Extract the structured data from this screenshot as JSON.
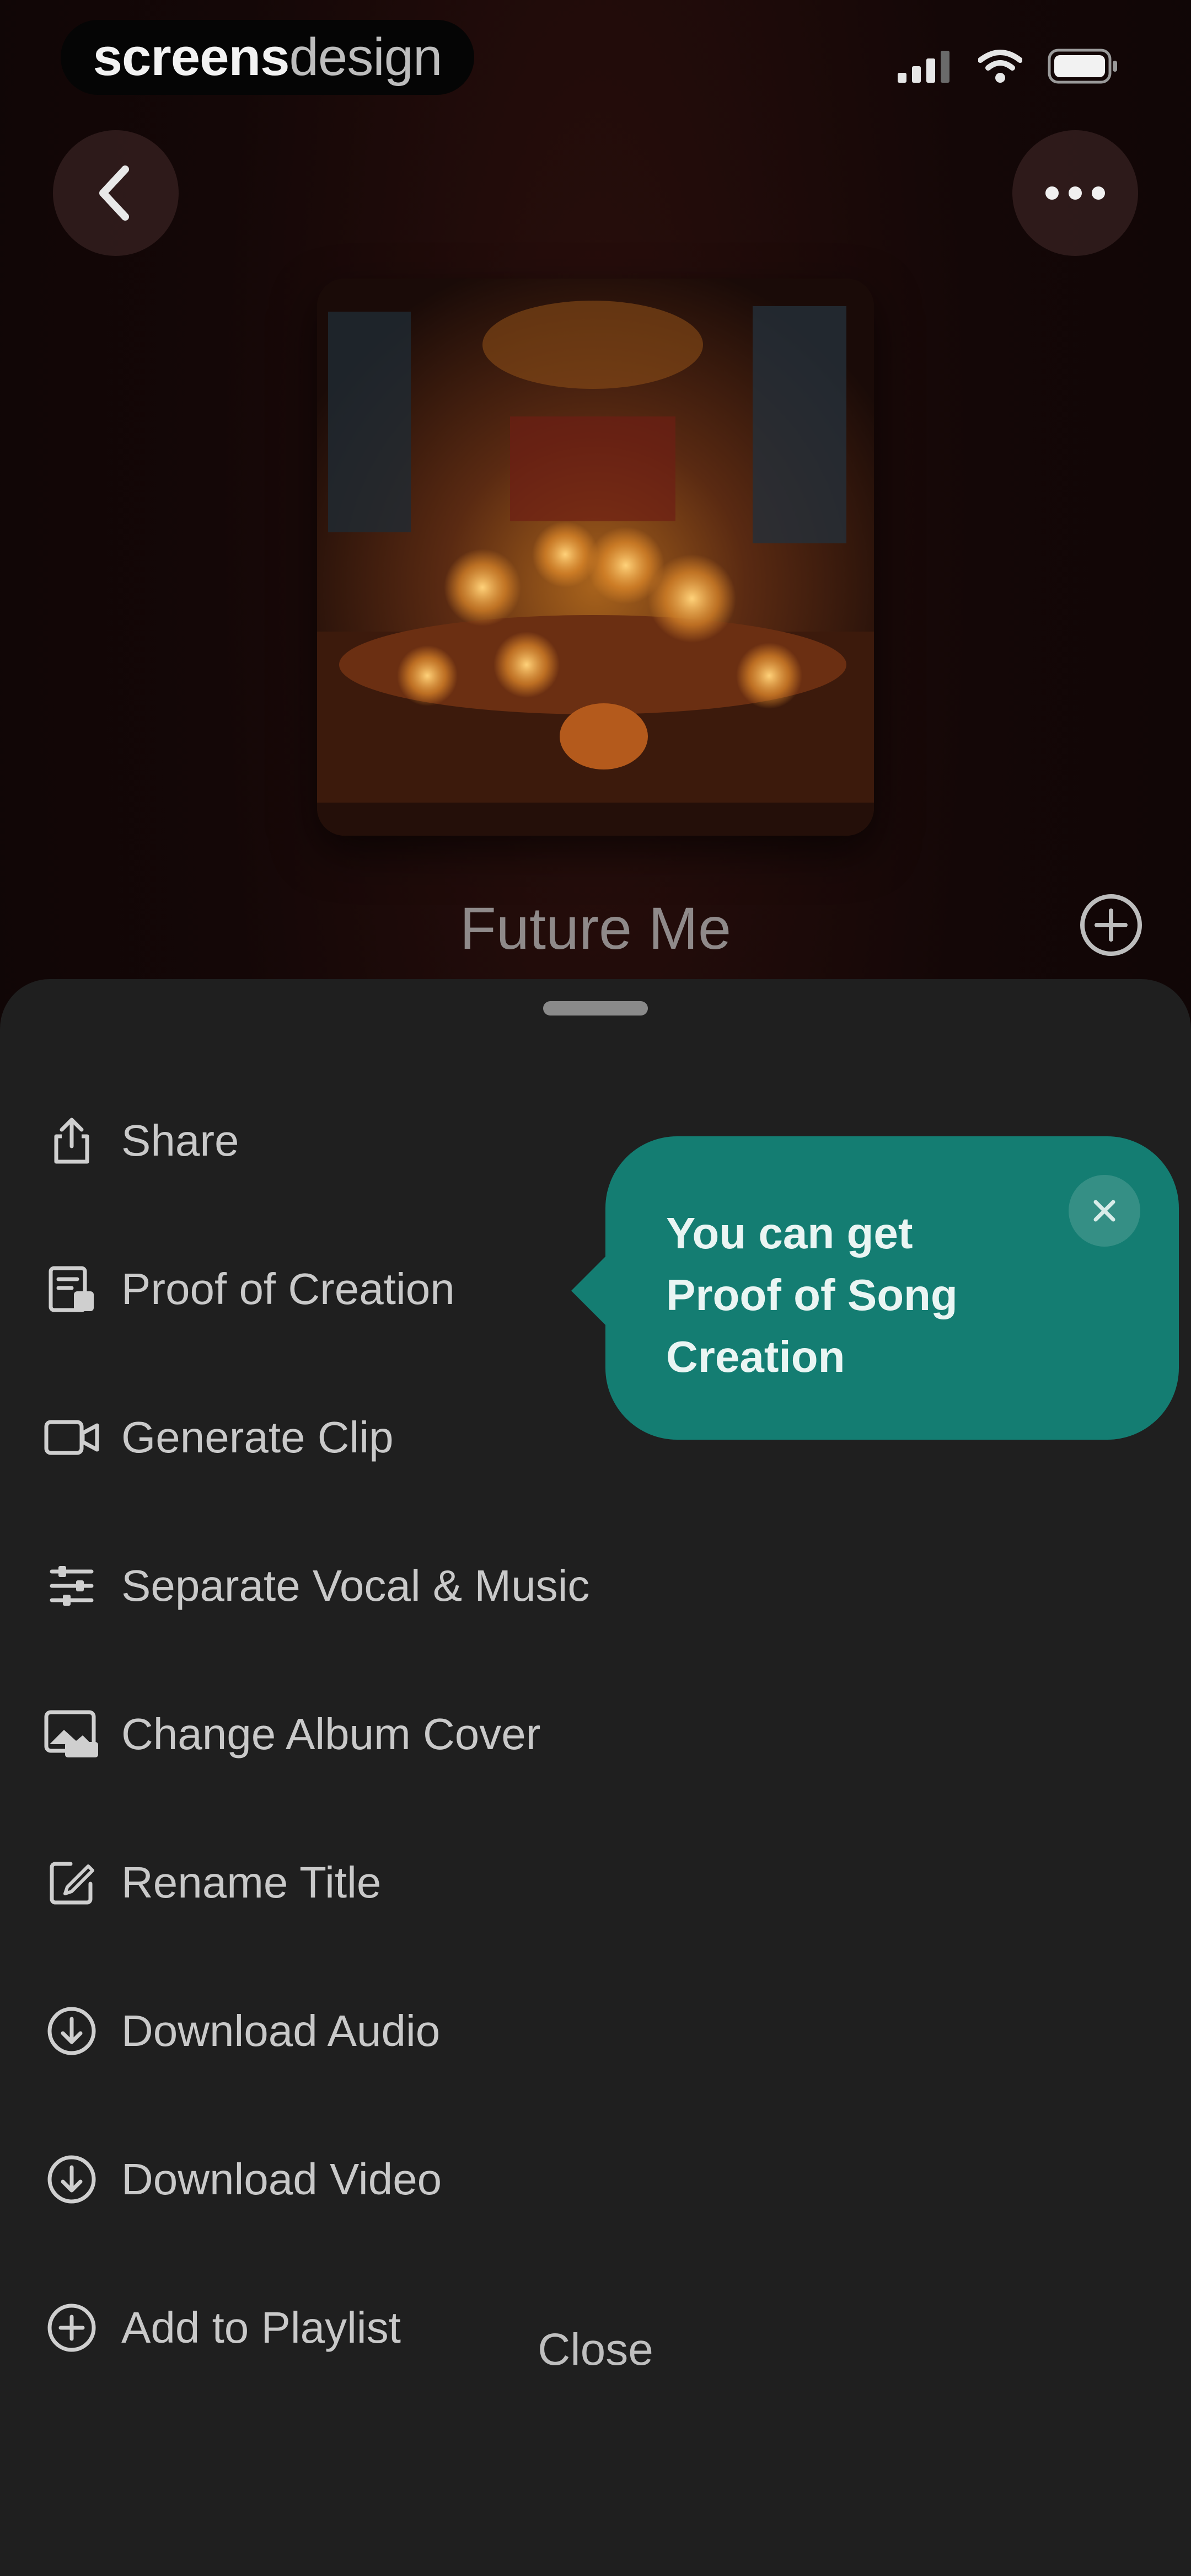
{
  "status_bar": {
    "brand_bold": "screens",
    "brand_light": "design",
    "icons": [
      "signal-icon",
      "wifi-icon",
      "battery-icon"
    ]
  },
  "header": {
    "back_icon": "chevron-left-icon",
    "more_icon": "ellipsis-icon"
  },
  "song": {
    "title": "Future Me",
    "add_icon": "plus-circle-icon"
  },
  "menu": {
    "items": [
      {
        "label": "Share",
        "icon": "share-icon"
      },
      {
        "label": "Proof of Creation",
        "icon": "certificate-icon"
      },
      {
        "label": "Generate Clip",
        "icon": "video-camera-icon"
      },
      {
        "label": "Separate Vocal & Music",
        "icon": "sliders-icon"
      },
      {
        "label": "Change Album Cover",
        "icon": "image-icon"
      },
      {
        "label": "Rename Title",
        "icon": "edit-icon"
      },
      {
        "label": "Download Audio",
        "icon": "download-icon"
      },
      {
        "label": "Download Video",
        "icon": "download-icon"
      },
      {
        "label": "Add to Playlist",
        "icon": "plus-circle-icon"
      }
    ],
    "close_label": "Close"
  },
  "tooltip": {
    "text": "You can get Proof of Song Creation",
    "close_icon": "close-icon"
  },
  "colors": {
    "background": "#120607",
    "sheet": "#1f1f1f",
    "tooltip": "#147d72",
    "menu_text": "#c9c9c9"
  }
}
